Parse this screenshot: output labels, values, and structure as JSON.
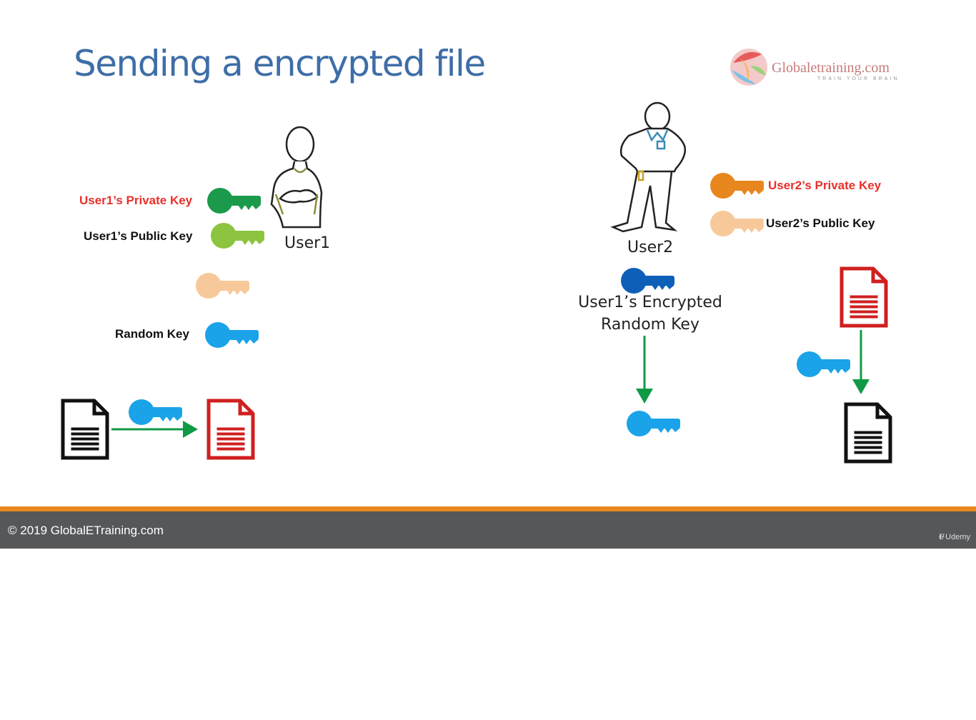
{
  "slide": {
    "title": "Sending a encrypted file",
    "logo": {
      "name": "Globaletraining.com",
      "tagline": "TRAIN YOUR BRAIN"
    },
    "labels": {
      "user1_private_key": "User1’s Private Key",
      "user1_public_key": "User1’s Public Key",
      "random_key": "Random Key",
      "user1": "User1",
      "user2": "User2",
      "user2_private_key": "User2’s Private Key",
      "user2_public_key": "User2’s Public Key",
      "encrypted_random_key_line1": "User1’s Encrypted",
      "encrypted_random_key_line2": "Random Key"
    },
    "colors": {
      "title": "#3e6ea7",
      "user1_private_key": "#1a9a4a",
      "user1_public_key": "#8cc43f",
      "user2_private_key": "#e8871e",
      "user2_public_key": "#f7c99a",
      "random_key": "#1aa3e8",
      "encrypted_random_key": "#0e5fb8",
      "encrypted_file": "#d01f1f",
      "arrow": "#109a45"
    }
  },
  "footer": {
    "copyright": "© 2019 GlobalETraining.com",
    "platform": "Udemy"
  }
}
